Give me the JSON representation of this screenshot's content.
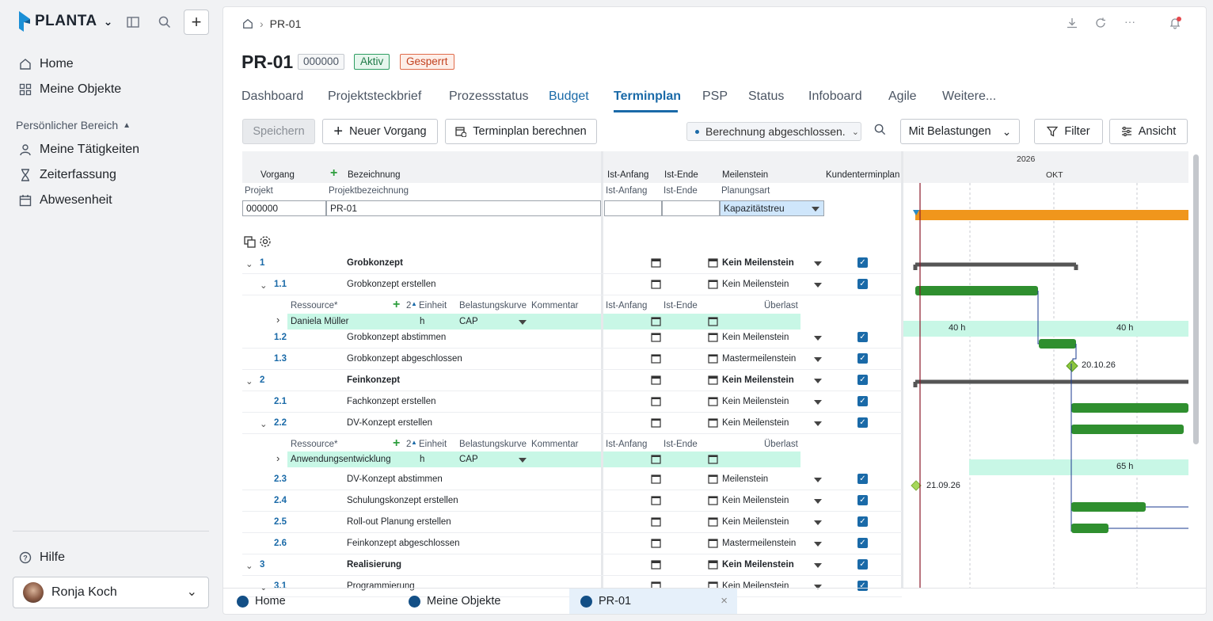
{
  "app": {
    "name": "PLANTA"
  },
  "sidebar": {
    "nav": [
      {
        "label": "Home",
        "icon": "home-icon"
      },
      {
        "label": "Meine Objekte",
        "icon": "grid-icon"
      }
    ],
    "section_label": "Persönlicher Bereich",
    "personal": [
      {
        "label": "Meine Tätigkeiten",
        "icon": "user-icon"
      },
      {
        "label": "Zeiterfassung",
        "icon": "hourglass-icon"
      },
      {
        "label": "Abwesenheit",
        "icon": "calendar-icon"
      }
    ],
    "help_label": "Hilfe",
    "user_name": "Ronja Koch"
  },
  "breadcrumb": {
    "current": "PR-01"
  },
  "project": {
    "title": "PR-01",
    "badge_id": "000000",
    "badge_status": "Aktiv",
    "badge_lock": "Gesperrt"
  },
  "tabs": [
    "Dashboard",
    "Projektsteckbrief",
    "Prozessstatus",
    "Budget",
    "Terminplan",
    "PSP",
    "Status",
    "Infoboard",
    "Agile",
    "Weitere..."
  ],
  "active_tab": "Terminplan",
  "toolbar": {
    "save": "Speichern",
    "new_task": "Neuer Vorgang",
    "calc": "Terminplan berechnen",
    "status": "Berechnung abgeschlossen.",
    "load": "Mit Belastungen",
    "filter": "Filter",
    "view": "Ansicht"
  },
  "grid": {
    "headers": {
      "vorgang": "Vorgang",
      "bezeichnung": "Bezeichnung",
      "ist_anfang": "Ist-Anfang",
      "ist_ende": "Ist-Ende",
      "meilenstein": "Meilenstein",
      "kunde": "Kundenterminplan"
    },
    "subheaders": {
      "projekt": "Projekt",
      "projektbez": "Projektbezeichnung",
      "ist_anfang": "Ist-Anfang",
      "ist_ende": "Ist-Ende",
      "planungsart": "Planungsart"
    },
    "project_row": {
      "projekt": "000000",
      "bez": "PR-01",
      "planungsart": "Kapazitätstreu"
    },
    "res_headers": {
      "ressource": "Ressource*",
      "count": "2",
      "einheit": "Einheit",
      "kurve": "Belastungskurve",
      "kommentar": "Kommentar",
      "ist_anfang": "Ist-Anfang",
      "ist_ende": "Ist-Ende",
      "ueberlast": "Überlast"
    },
    "rows": [
      {
        "num": "1",
        "name": "Grobkonzept",
        "mile": "Kein Meilenstein",
        "bold": true
      },
      {
        "num": "1.1",
        "name": "Grobkonzept erstellen",
        "mile": "Kein Meilenstein"
      },
      {
        "num": "1.2",
        "name": "Grobkonzept abstimmen",
        "mile": "Kein Meilenstein"
      },
      {
        "num": "1.3",
        "name": "Grobkonzept abgeschlossen",
        "mile": "Mastermeilenstein"
      },
      {
        "num": "2",
        "name": "Feinkonzept",
        "mile": "Kein Meilenstein",
        "bold": true
      },
      {
        "num": "2.1",
        "name": "Fachkonzept erstellen",
        "mile": "Kein Meilenstein"
      },
      {
        "num": "2.2",
        "name": "DV-Konzept erstellen",
        "mile": "Kein Meilenstein"
      },
      {
        "num": "2.3",
        "name": "DV-Konzept abstimmen",
        "mile": "Meilenstein"
      },
      {
        "num": "2.4",
        "name": "Schulungskonzept erstellen",
        "mile": "Kein Meilenstein"
      },
      {
        "num": "2.5",
        "name": "Roll-out Planung erstellen",
        "mile": "Kein Meilenstein"
      },
      {
        "num": "2.6",
        "name": "Feinkonzept abgeschlossen",
        "mile": "Mastermeilenstein"
      },
      {
        "num": "3",
        "name": "Realisierung",
        "mile": "Kein Meilenstein",
        "bold": true
      },
      {
        "num": "3.1",
        "name": "Programmierung",
        "mile": "Kein Meilenstein"
      }
    ],
    "resources": [
      {
        "name": "Daniela Müller",
        "unit": "h",
        "curve": "CAP"
      },
      {
        "name": "Anwendungsentwicklung",
        "unit": "h",
        "curve": "CAP"
      }
    ]
  },
  "gantt": {
    "year": "2026",
    "month": "OKT",
    "load1a": "40 h",
    "load1b": "40 h",
    "load2": "65 h",
    "date1": "20.10.26",
    "date2": "21.09.26",
    "colors": {
      "project_bar": "#f0961c",
      "task_bar": "#2f8f2f",
      "milestone": "#8cc63e",
      "today_line": "#8b1a2b"
    }
  },
  "bottom_tabs": [
    "Home",
    "Meine Objekte",
    "PR-01"
  ]
}
